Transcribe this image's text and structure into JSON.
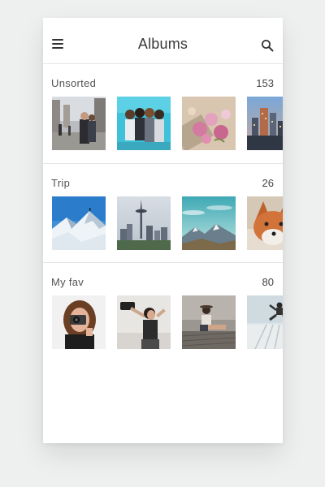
{
  "appbar": {
    "title": "Albums",
    "menu_icon": "hamburger-menu-icon",
    "search_icon": "search-icon"
  },
  "albums": [
    {
      "name": "Unsorted",
      "count": "153",
      "photos": [
        "street-couple-photo",
        "group-of-friends-photo",
        "pink-roses-photo",
        "city-skyline-photo"
      ]
    },
    {
      "name": "Trip",
      "count": "26",
      "photos": [
        "snowy-mountain-peak-photo",
        "seattle-space-needle-photo",
        "mountain-valley-photo",
        "fox-photo"
      ]
    },
    {
      "name": "My fav",
      "count": "80",
      "photos": [
        "woman-with-camera-photo",
        "woman-with-camera-black-shirt-photo",
        "woman-on-pier-photo",
        "person-jumping-photo"
      ]
    }
  ],
  "colors": {
    "background": "#eef0ef",
    "card": "#ffffff",
    "text": "#3a3a3a",
    "divider": "#e4e4e4"
  }
}
